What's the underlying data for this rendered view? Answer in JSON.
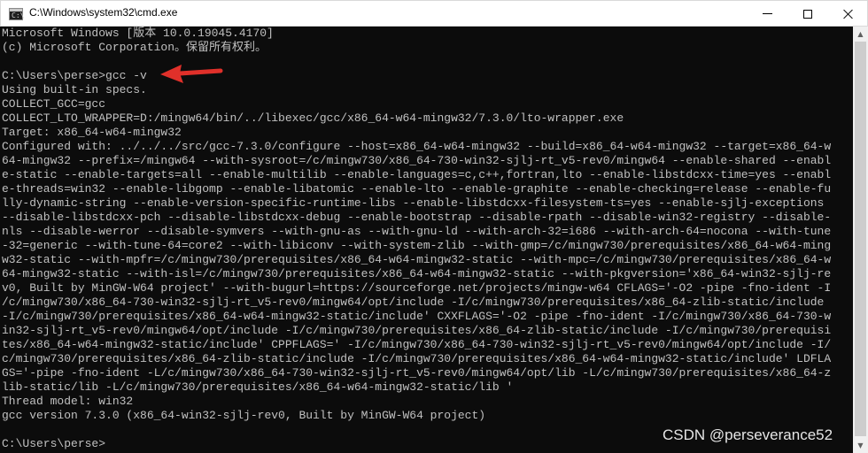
{
  "window": {
    "title": "C:\\Windows\\system32\\cmd.exe",
    "app_icon_text": "C:\\"
  },
  "console": {
    "lines": [
      "Microsoft Windows [版本 10.0.19045.4170]",
      "(c) Microsoft Corporation。保留所有权利。",
      "",
      "C:\\Users\\perse>gcc -v",
      "Using built-in specs.",
      "COLLECT_GCC=gcc",
      "COLLECT_LTO_WRAPPER=D:/mingw64/bin/../libexec/gcc/x86_64-w64-mingw32/7.3.0/lto-wrapper.exe",
      "Target: x86_64-w64-mingw32",
      "Configured with: ../../../src/gcc-7.3.0/configure --host=x86_64-w64-mingw32 --build=x86_64-w64-mingw32 --target=x86_64-w",
      "64-mingw32 --prefix=/mingw64 --with-sysroot=/c/mingw730/x86_64-730-win32-sjlj-rt_v5-rev0/mingw64 --enable-shared --enabl",
      "e-static --enable-targets=all --enable-multilib --enable-languages=c,c++,fortran,lto --enable-libstdcxx-time=yes --enabl",
      "e-threads=win32 --enable-libgomp --enable-libatomic --enable-lto --enable-graphite --enable-checking=release --enable-fu",
      "lly-dynamic-string --enable-version-specific-runtime-libs --enable-libstdcxx-filesystem-ts=yes --enable-sjlj-exceptions",
      "--disable-libstdcxx-pch --disable-libstdcxx-debug --enable-bootstrap --disable-rpath --disable-win32-registry --disable-",
      "nls --disable-werror --disable-symvers --with-gnu-as --with-gnu-ld --with-arch-32=i686 --with-arch-64=nocona --with-tune",
      "-32=generic --with-tune-64=core2 --with-libiconv --with-system-zlib --with-gmp=/c/mingw730/prerequisites/x86_64-w64-ming",
      "w32-static --with-mpfr=/c/mingw730/prerequisites/x86_64-w64-mingw32-static --with-mpc=/c/mingw730/prerequisites/x86_64-w",
      "64-mingw32-static --with-isl=/c/mingw730/prerequisites/x86_64-w64-mingw32-static --with-pkgversion='x86_64-win32-sjlj-re",
      "v0, Built by MinGW-W64 project' --with-bugurl=https://sourceforge.net/projects/mingw-w64 CFLAGS='-O2 -pipe -fno-ident -I",
      "/c/mingw730/x86_64-730-win32-sjlj-rt_v5-rev0/mingw64/opt/include -I/c/mingw730/prerequisites/x86_64-zlib-static/include",
      "-I/c/mingw730/prerequisites/x86_64-w64-mingw32-static/include' CXXFLAGS='-O2 -pipe -fno-ident -I/c/mingw730/x86_64-730-w",
      "in32-sjlj-rt_v5-rev0/mingw64/opt/include -I/c/mingw730/prerequisites/x86_64-zlib-static/include -I/c/mingw730/prerequisi",
      "tes/x86_64-w64-mingw32-static/include' CPPFLAGS=' -I/c/mingw730/x86_64-730-win32-sjlj-rt_v5-rev0/mingw64/opt/include -I/",
      "c/mingw730/prerequisites/x86_64-zlib-static/include -I/c/mingw730/prerequisites/x86_64-w64-mingw32-static/include' LDFLA",
      "GS='-pipe -fno-ident -L/c/mingw730/x86_64-730-win32-sjlj-rt_v5-rev0/mingw64/opt/lib -L/c/mingw730/prerequisites/x86_64-z",
      "lib-static/lib -L/c/mingw730/prerequisites/x86_64-w64-mingw32-static/lib '",
      "Thread model: win32",
      "gcc version 7.3.0 (x86_64-win32-sjlj-rev0, Built by MinGW-W64 project)",
      "",
      "C:\\Users\\perse>"
    ]
  },
  "watermark": "CSDN @perseverance52",
  "colors": {
    "console_bg": "#0c0c0c",
    "console_text": "#c0c0c0",
    "annotation_arrow": "#e0302a"
  }
}
